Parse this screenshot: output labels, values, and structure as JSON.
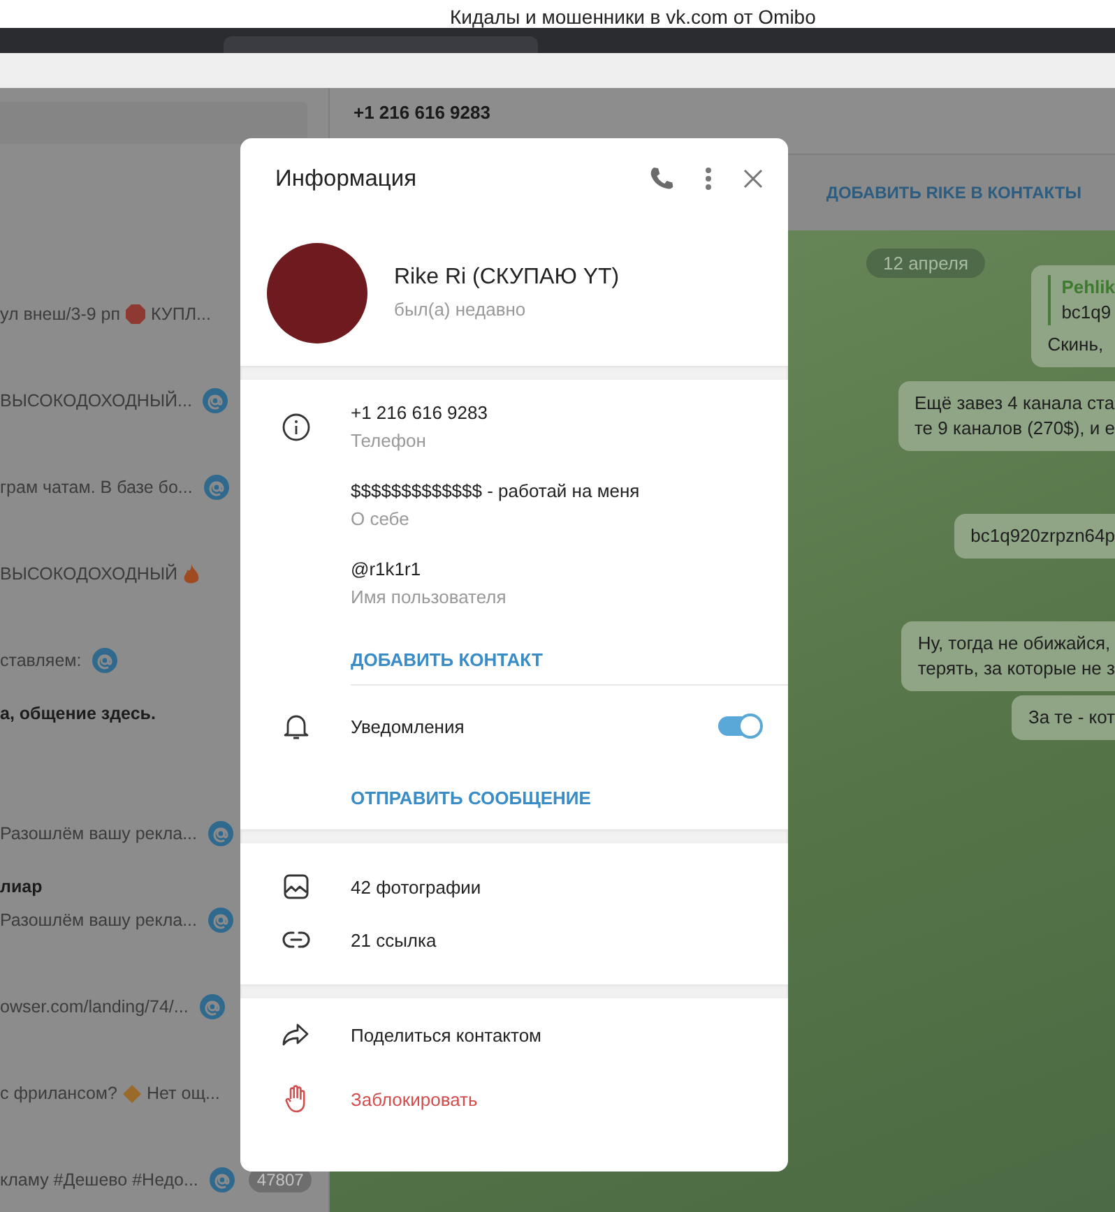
{
  "browser": {
    "tab_title": "Кидалы и мошенники в vk.com от Omibo"
  },
  "chat_list": {
    "items": [
      {
        "preview": [
          {
            "kind": "text",
            "text": "ул внеш/3-9 рп"
          },
          {
            "kind": "stop"
          },
          {
            "kind": "text",
            "text": "КУПЛ..."
          }
        ],
        "mention": false
      },
      {
        "preview": [
          {
            "kind": "text",
            "text": "ВЫСОКОДОХОДНЫЙ..."
          }
        ],
        "mention": true
      },
      {
        "preview": [
          {
            "kind": "text",
            "text": "грам чатам.   В базе бо..."
          }
        ],
        "mention": true
      },
      {
        "preview": [
          {
            "kind": "text",
            "text": "ВЫСОКОДОХОДНЫЙ"
          },
          {
            "kind": "fire"
          }
        ],
        "mention": false
      },
      {
        "preview": [
          {
            "kind": "text",
            "text": "ставляем:"
          }
        ],
        "mention": true
      },
      {
        "title": "а, общение здесь.",
        "mention": false
      },
      {
        "preview": [
          {
            "kind": "text",
            "text": "Разошлём вашу рекла..."
          }
        ],
        "mention": true
      },
      {
        "title": "лиар",
        "preview": [
          {
            "kind": "text",
            "text": "Разошлём вашу рекла..."
          }
        ],
        "mention": true
      },
      {
        "preview": [
          {
            "kind": "text",
            "text": "owser.com/landing/74/..."
          }
        ],
        "mention": true
      },
      {
        "preview": [
          {
            "kind": "text",
            "text": "с фрилансом?"
          },
          {
            "kind": "diamond"
          },
          {
            "kind": "text",
            "text": "Нет ощ..."
          }
        ],
        "mention": false
      },
      {
        "preview": [
          {
            "kind": "text",
            "text": "кламу #Дешево #Недо..."
          }
        ],
        "mention": true,
        "unread_count": "47807"
      }
    ]
  },
  "chat": {
    "phone": "+1 216 616 9283",
    "add_contact_bar": "ДОБАВИТЬ RIKE В КОНТАКТЫ",
    "date": "12 апреля",
    "messages": [
      {
        "reply": {
          "author": "Pehlik",
          "text": "bc1q9"
        },
        "lines": [
          "Скинь,"
        ]
      },
      {
        "lines": [
          "Ещё завез 4 канала ста",
          "те 9 каналов (270$), и е"
        ]
      },
      {
        "lines": [
          "bc1q920zrpzn64p"
        ]
      },
      {
        "lines": [
          "Ну, тогда не обижайся,",
          "терять, за которые не з"
        ]
      },
      {
        "lines": [
          "За те - кот"
        ]
      }
    ]
  },
  "info_dialog": {
    "title": "Информация",
    "name": "Rike Ri (СКУПАЮ YT)",
    "status": "был(а) недавно",
    "details": [
      {
        "value": "+1 216 616 9283",
        "label": "Телефон"
      },
      {
        "value": "$$$$$$$$$$$$$ - работай на меня",
        "label": "О себе"
      },
      {
        "value": "@r1k1r1",
        "label": "Имя пользователя"
      }
    ],
    "add_contact": "ДОБАВИТЬ КОНТАКТ",
    "notifications": {
      "label": "Уведомления",
      "on": true
    },
    "send_message": "ОТПРАВИТЬ СООБЩЕНИЕ",
    "media": [
      {
        "kind": "photos",
        "label": "42 фотографии"
      },
      {
        "kind": "links",
        "label": "21 ссылка"
      }
    ],
    "actions": [
      {
        "kind": "share",
        "label": "Поделиться контактом"
      },
      {
        "kind": "block",
        "label": "Заблокировать"
      }
    ]
  }
}
